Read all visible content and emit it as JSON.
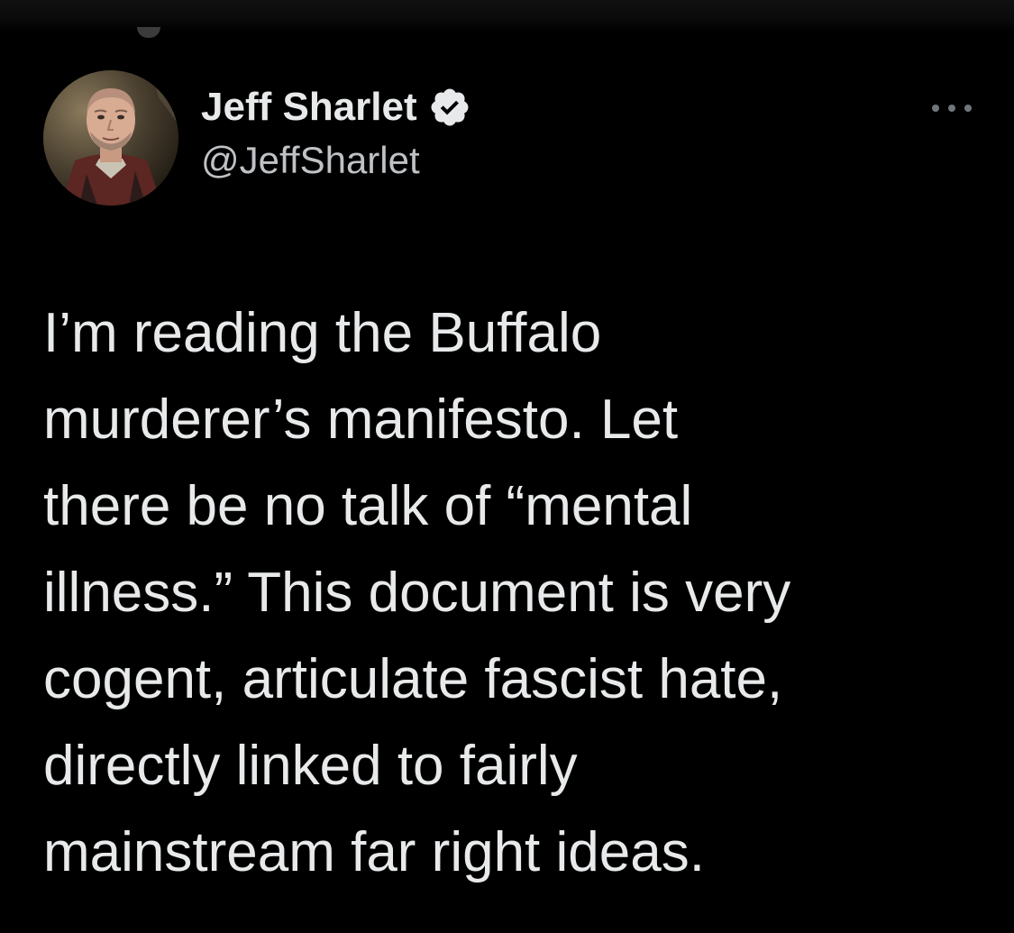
{
  "author": {
    "display_name": "Jeff Sharlet",
    "handle": "@JeffSharlet",
    "verified": true,
    "verified_badge_color": "#e7e9ea"
  },
  "tweet": {
    "text": "I’m reading the Buffalo\nmurderer’s manifesto. Let\nthere be no talk of “mental\nillness.” This document is very\ncogent, articulate fascist hate,\ndirectly linked to fairly\nmainstream far right ideas."
  },
  "icons": {
    "verified": "verified-badge-icon",
    "more": "more-options-icon"
  },
  "theme": {
    "background": "#000000",
    "text_primary": "#e7e9ea",
    "text_secondary": "#bfc2c5",
    "icon_muted": "#71767b"
  }
}
